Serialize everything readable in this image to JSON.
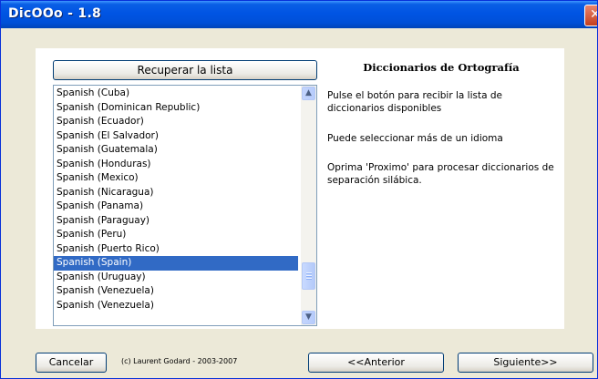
{
  "window": {
    "title": "DicOOo - 1.8",
    "close_icon": "close-icon"
  },
  "left": {
    "recover_button_label": "Recuperar la lista",
    "languages": [
      "Spanish (Cuba)",
      "Spanish (Dominican Republic)",
      "Spanish (Ecuador)",
      "Spanish (El Salvador)",
      "Spanish (Guatemala)",
      "Spanish (Honduras)",
      "Spanish (Mexico)",
      "Spanish (Nicaragua)",
      "Spanish (Panama)",
      "Spanish (Paraguay)",
      "Spanish (Peru)",
      "Spanish (Puerto Rico)",
      "Spanish (Spain)",
      "Spanish (Uruguay)",
      "Spanish (Venezuela)",
      "Spanish (Venezuela)"
    ],
    "selected_language": "Spanish (Spain)",
    "scrollbar_icons": [
      "chevron-up-icon",
      "chevron-down-icon"
    ]
  },
  "right": {
    "title": "Diccionarios de Ortografía",
    "paragraph1": "Pulse el botón para recibir la lista de diccionarios disponibles",
    "paragraph2": "Puede seleccionar más de un idioma",
    "paragraph3": "Oprima 'Proximo' para procesar diccionarios de separación silábica."
  },
  "footer": {
    "cancel_label": "Cancelar",
    "copyright": "(c) Laurent Godard - 2003-2007",
    "prev_label": "<<Anterior",
    "next_label": "Siguiente>>"
  },
  "colors": {
    "titlebar": "#0054e3",
    "dialog_bg": "#ece9d8",
    "selection": "#316ac5"
  }
}
